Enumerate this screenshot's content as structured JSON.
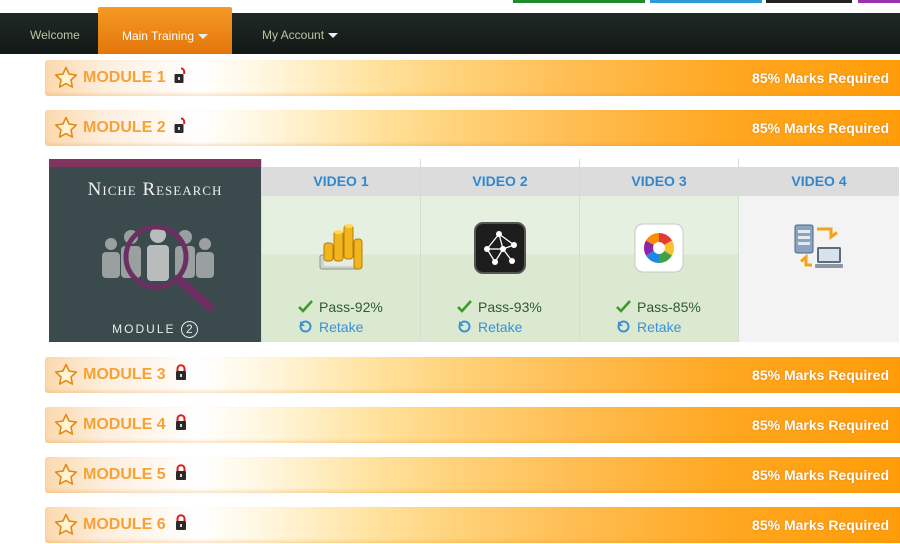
{
  "nav": {
    "items": [
      {
        "label": "Welcome",
        "active": false,
        "dropdown": false
      },
      {
        "label": "Main Training",
        "active": true,
        "dropdown": true
      },
      {
        "label": "My Account",
        "active": false,
        "dropdown": true
      }
    ]
  },
  "modules": [
    {
      "title": "MODULE 1",
      "marks": "85% Marks Required",
      "locked": false
    },
    {
      "title": "MODULE 2",
      "marks": "85% Marks Required",
      "locked": false
    },
    {
      "title": "MODULE 3",
      "marks": "85% Marks Required",
      "locked": true
    },
    {
      "title": "MODULE 4",
      "marks": "85% Marks Required",
      "locked": true
    },
    {
      "title": "MODULE 5",
      "marks": "85% Marks Required",
      "locked": true
    },
    {
      "title": "MODULE 6",
      "marks": "85% Marks Required",
      "locked": true
    }
  ],
  "expanded_module": {
    "thumbnail": {
      "title": "Niche Research",
      "module_label": "MODULE",
      "module_number": "2"
    },
    "videos": [
      {
        "label": "VIDEO 1",
        "icon": "gold-coins-icon",
        "status": "Pass-92%",
        "retake": "Retake",
        "completed": true
      },
      {
        "label": "VIDEO 2",
        "icon": "network-nodes-icon",
        "status": "Pass-93%",
        "retake": "Retake",
        "completed": true
      },
      {
        "label": "VIDEO 3",
        "icon": "picasa-pinwheel-icon",
        "status": "Pass-85%",
        "retake": "Retake",
        "completed": true
      },
      {
        "label": "VIDEO 4",
        "icon": "server-transfer-icon",
        "status": "",
        "retake": "",
        "completed": false
      }
    ]
  },
  "colors": {
    "nav_bg": "#1a221e",
    "nav_active": "#f08a17",
    "module_title": "#f6a238",
    "video_header_text": "#2e88d0",
    "pass_text": "#2f5a2f",
    "retake_text": "#3d8fd6",
    "completed_bg": "#e4efdd",
    "pending_bg": "#f3f3f3"
  }
}
